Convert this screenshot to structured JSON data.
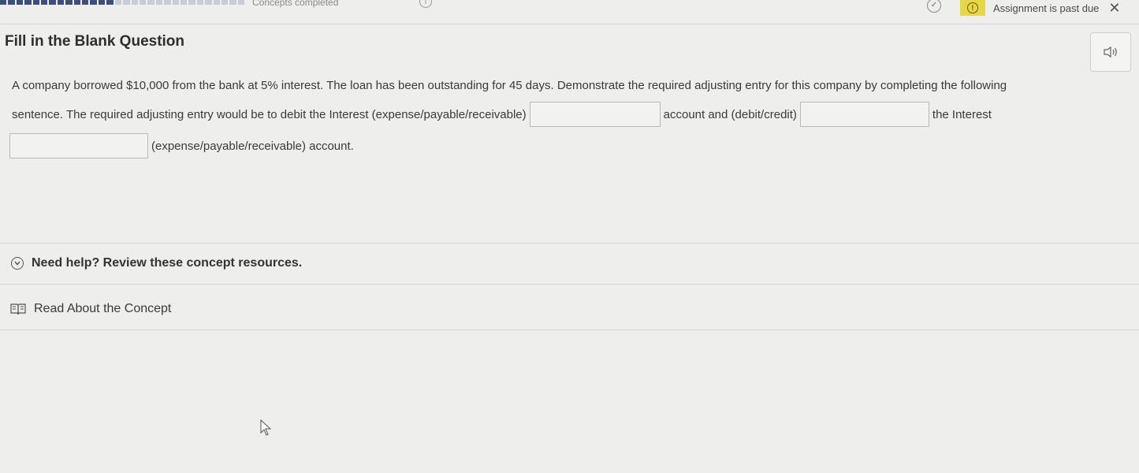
{
  "header": {
    "concepts_completed": "Concepts completed",
    "info_glyph": "i",
    "check_glyph": "✓",
    "alert_glyph": "!",
    "past_due": "Assignment is past due",
    "close_glyph": "✕",
    "icons": {
      "info": "info-icon",
      "check": "check-circle-icon",
      "alert": "alert-icon",
      "close": "close-icon"
    },
    "colors": {
      "alert_bg": "#e6d64a",
      "progress_done": "#3b4f7a",
      "progress_todo": "#c9ccd4"
    }
  },
  "question": {
    "title": "Fill in the Blank Question",
    "line1": "A company borrowed $10,000 from the bank at 5% interest. The loan has been outstanding for 45 days. Demonstrate the required adjusting entry for this company by completing the following",
    "line2_a": "sentence. The required adjusting entry would be to debit the Interest (expense/payable/receivable)",
    "line2_b": "account and (debit/credit)",
    "line2_c": "the Interest",
    "line3_a": "(expense/payable/receivable) account.",
    "blanks": [
      {
        "value": ""
      },
      {
        "value": ""
      },
      {
        "value": ""
      }
    ],
    "audio_icon": "speaker-icon"
  },
  "help": {
    "label": "Need help? Review these concept resources.",
    "icon": "chevron-down-icon"
  },
  "resource": {
    "label": "Read About the Concept",
    "icon": "book-icon"
  }
}
